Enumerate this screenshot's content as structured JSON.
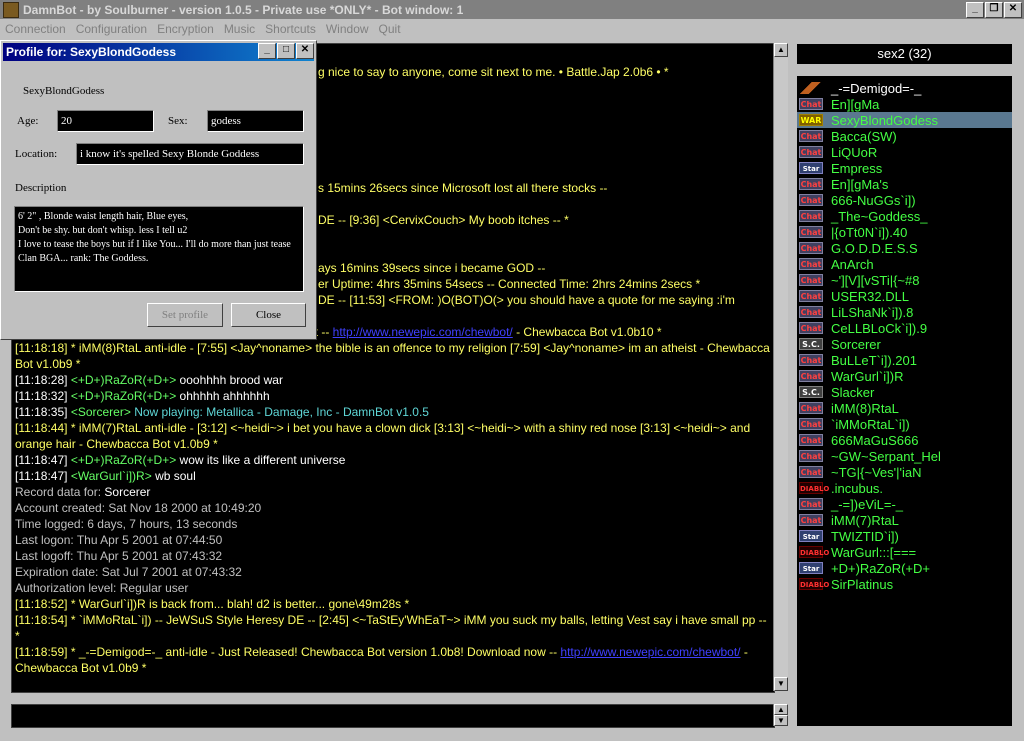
{
  "app": {
    "title": "DamnBot - by Soulburner - version 1.0.5 - Private use *ONLY* - Bot window: 1",
    "window_buttons": [
      "_",
      "❐",
      "✕"
    ]
  },
  "menu": [
    "Connection",
    "Configuration",
    "Encryption",
    "Music",
    "Shortcuts",
    "Window",
    "Quit"
  ],
  "profile": {
    "title": "Profile for: SexyBlondGodess",
    "username": "SexyBlondGodess",
    "age_label": "Age:",
    "age": "20",
    "sex_label": "Sex:",
    "sex": "godess",
    "location_label": "Location:",
    "location": "i know it's spelled Sexy Blonde Goddess",
    "description_label": "Description",
    "description": [
      "6' 2\" , Blonde waist length hair, Blue eyes,",
      "Don't be shy. but don't whisp. less I tell u2",
      "I love to tease the boys but if I like You... I'll do more than just tease",
      "Clan BGA... rank:  The Goddess."
    ],
    "set_profile_label": "Set profile",
    "close_label": "Close"
  },
  "chat": {
    "partial_lines": [
      {
        "text": "g nice to say to anyone, come sit next to me. • Battle.Jap 2.0b6 • *",
        "color": "yellow"
      },
      {
        "text": "s 15mins 26secs since Microsoft lost all there stocks --",
        "color": "yellow"
      },
      {
        "text": "DE -- [9:36] <CervixCouch> My boob itches -- *",
        "color": "yellow"
      },
      {
        "text": "ays 16mins 39secs since i became GOD --",
        "color": "yellow"
      },
      {
        "text": "er Uptime: 4hrs 35mins 54secs -- Connected Time: 2hrs 24mins 2secs *",
        "color": "yellow"
      },
      {
        "text": "DE -- [11:53] <FROM: )O(BOT)O(> you should have a quote for me saying :i'm",
        "color": "yellow"
      },
      {
        "text": "ot -- ",
        "color": "yellow",
        "link": "http://www.newepic.com/chewbot/",
        "after": " - Chewbacca Bot v1.0b10 *"
      }
    ],
    "lines": [
      {
        "segments": [
          {
            "t": "[11:18:18] * iMM(8)RtaL anti-idle - [7:55] <Jay^noname> the bible is an offence to my religion [7:59] <Jay^noname> im an atheist - Chewbacca Bot v1.0b9 *",
            "c": "y"
          }
        ]
      },
      {
        "segments": [
          {
            "t": "[11:18:28] ",
            "c": "w"
          },
          {
            "t": "<+D+)RaZoR(+D+>",
            "c": "g"
          },
          {
            "t": " ooohhhh brood war",
            "c": "w"
          }
        ]
      },
      {
        "segments": [
          {
            "t": "[11:18:32] ",
            "c": "w"
          },
          {
            "t": "<+D+)RaZoR(+D+>",
            "c": "g"
          },
          {
            "t": " ohhhhh ahhhhhh",
            "c": "w"
          }
        ]
      },
      {
        "segments": [
          {
            "t": "[11:18:35] ",
            "c": "w"
          },
          {
            "t": "<Sorcerer>",
            "c": "g"
          },
          {
            "t": " Now playing: Metallica - Damage, Inc - DamnBot v1.0.5",
            "c": "c"
          }
        ]
      },
      {
        "segments": [
          {
            "t": "[11:18:44] * iMM(7)RtaL anti-idle - [3:12] <~heidi~> i bet you have a clown dick [3:13] <~heidi~> with a shiny red nose [3:13] <~heidi~> and orange hair - Chewbacca Bot v1.0b9 *",
            "c": "y"
          }
        ]
      },
      {
        "segments": [
          {
            "t": "[11:18:47] ",
            "c": "w"
          },
          {
            "t": "<+D+)RaZoR(+D+>",
            "c": "g"
          },
          {
            "t": " wow its like a different universe",
            "c": "w"
          }
        ]
      },
      {
        "segments": [
          {
            "t": "[11:18:47] ",
            "c": "w"
          },
          {
            "t": "<WarGurl`i])R>",
            "c": "g"
          },
          {
            "t": " wb soul",
            "c": "w"
          }
        ]
      },
      {
        "segments": [
          {
            "t": "Record data for: ",
            "c": "gr"
          },
          {
            "t": "Sorcerer",
            "c": "w"
          }
        ]
      },
      {
        "segments": [
          {
            "t": "Account created: Sat Nov 18 2000 at 10:49:20",
            "c": "gr"
          }
        ]
      },
      {
        "segments": [
          {
            "t": "Time logged: 6 days, 7 hours, 13 seconds",
            "c": "gr"
          }
        ]
      },
      {
        "segments": [
          {
            "t": "Last logon: Thu Apr 5 2001 at 07:44:50",
            "c": "gr"
          }
        ]
      },
      {
        "segments": [
          {
            "t": "Last logoff: Thu Apr 5 2001 at 07:43:32",
            "c": "gr"
          }
        ]
      },
      {
        "segments": [
          {
            "t": "Expiration date: Sat Jul 7 2001 at 07:43:32",
            "c": "gr"
          }
        ]
      },
      {
        "segments": [
          {
            "t": "Authorization level: Regular user",
            "c": "gr"
          }
        ]
      },
      {
        "segments": [
          {
            "t": "[11:18:52] * WarGurl`i])R is back from... blah! d2 is better... gone\\49m28s *",
            "c": "y"
          }
        ]
      },
      {
        "segments": [
          {
            "t": "[11:18:54] * `iMMoRtaL`i]) -- JeWSuS Style Heresy DE -- [2:45] <~TaStEy'WhEaT~> iMM you suck my balls, letting Vest say i have small pp -- *",
            "c": "y"
          }
        ]
      },
      {
        "segments": [
          {
            "t": "[11:18:59] * _-=Demigod=-_ anti-idle - Just Released! Chewbacca Bot version 1.0b8! Download now -- ",
            "c": "y"
          },
          {
            "t": "http://www.newepic.com/chewbot/",
            "c": "link"
          },
          {
            "t": " - Chewbacca Bot v1.0b9 *",
            "c": "y"
          }
        ]
      }
    ]
  },
  "channel": {
    "label": "sex2  (32)"
  },
  "users": [
    {
      "name": "_-=Demigod=-_",
      "badge": "op",
      "badge_text": "",
      "op": true
    },
    {
      "name": "En][gMa",
      "badge": "chat",
      "badge_text": "Chat"
    },
    {
      "name": "SexyBlondGodess",
      "badge": "war",
      "badge_text": "WAR",
      "selected": true
    },
    {
      "name": "Bacca(SW)",
      "badge": "chat",
      "badge_text": "Chat"
    },
    {
      "name": "LiQUoR",
      "badge": "chat",
      "badge_text": "Chat"
    },
    {
      "name": "Empress",
      "badge": "star",
      "badge_text": "Star"
    },
    {
      "name": "En][gMa's",
      "badge": "chat",
      "badge_text": "Chat"
    },
    {
      "name": "666-NuGGs`i])",
      "badge": "chat",
      "badge_text": "Chat"
    },
    {
      "name": "_The~Goddess_",
      "badge": "chat",
      "badge_text": "Chat"
    },
    {
      "name": "|{oTt0N`i]).40",
      "badge": "chat",
      "badge_text": "Chat"
    },
    {
      "name": "G.O.D.D.E.S.S",
      "badge": "chat",
      "badge_text": "Chat"
    },
    {
      "name": "AnArch",
      "badge": "chat",
      "badge_text": "Chat"
    },
    {
      "name": "~'][V][vSTi|{~#8",
      "badge": "chat",
      "badge_text": "Chat"
    },
    {
      "name": "USER32.DLL",
      "badge": "chat",
      "badge_text": "Chat"
    },
    {
      "name": "LiLShaNk`i]).8",
      "badge": "chat",
      "badge_text": "Chat"
    },
    {
      "name": "CeLLBLoCk`i]).9",
      "badge": "chat",
      "badge_text": "Chat"
    },
    {
      "name": "Sorcerer",
      "badge": "sc",
      "badge_text": "S.C."
    },
    {
      "name": "BuLLeT`i]).201",
      "badge": "chat",
      "badge_text": "Chat"
    },
    {
      "name": "WarGurl`i])R",
      "badge": "chat",
      "badge_text": "Chat"
    },
    {
      "name": "Slacker",
      "badge": "sc",
      "badge_text": "S.C."
    },
    {
      "name": "iMM(8)RtaL",
      "badge": "chat",
      "badge_text": "Chat"
    },
    {
      "name": "`iMMoRtaL`i])",
      "badge": "chat",
      "badge_text": "Chat"
    },
    {
      "name": "666MaGuS666",
      "badge": "chat",
      "badge_text": "Chat"
    },
    {
      "name": "~GW~Serpant_Hel",
      "badge": "chat",
      "badge_text": "Chat"
    },
    {
      "name": "~TG|{~Ves'|'iaN",
      "badge": "chat",
      "badge_text": "Chat"
    },
    {
      "name": ".incubus.",
      "badge": "diablo",
      "badge_text": "DIABLO"
    },
    {
      "name": "_-=])eViL=-_",
      "badge": "chat",
      "badge_text": "Chat"
    },
    {
      "name": "iMM(7)RtaL",
      "badge": "chat",
      "badge_text": "Chat"
    },
    {
      "name": "TWIZTID`i])",
      "badge": "star",
      "badge_text": "Star"
    },
    {
      "name": "WarGurl:::[===",
      "badge": "diablo",
      "badge_text": "DIABLO"
    },
    {
      "name": "+D+)RaZoR(+D+",
      "badge": "star",
      "badge_text": "Star"
    },
    {
      "name": "SirPlatinus",
      "badge": "diablo",
      "badge_text": "DIABLO"
    }
  ]
}
